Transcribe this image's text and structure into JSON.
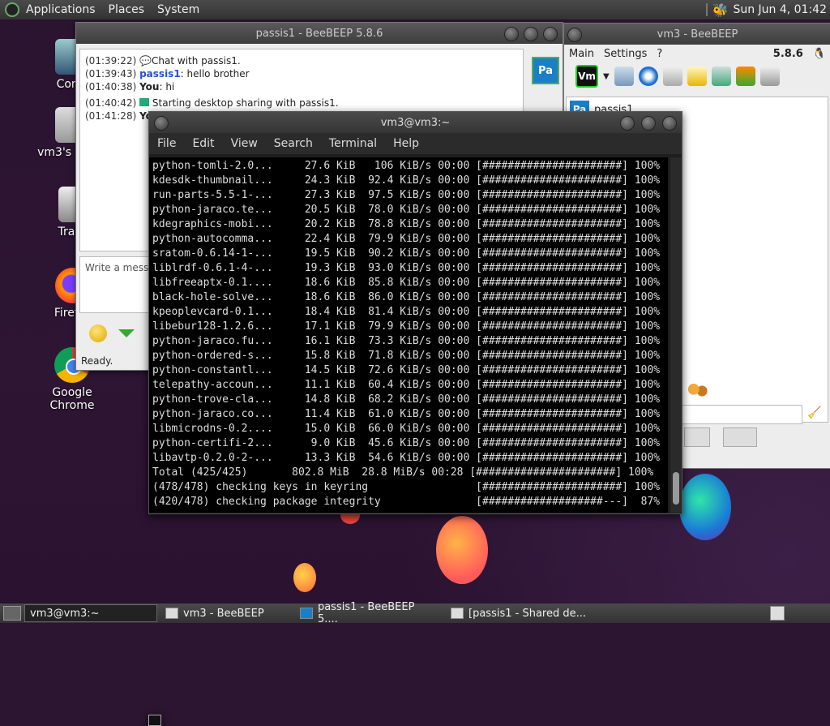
{
  "topbar": {
    "menus": [
      "Applications",
      "Places",
      "System"
    ],
    "clock": "Sun Jun  4, 01:42"
  },
  "desktop_icons": [
    {
      "label": "Comp"
    },
    {
      "label": "vm3's Home"
    },
    {
      "label": "Trash"
    },
    {
      "label": "Firefox"
    },
    {
      "label": "Google Chrome"
    }
  ],
  "chat_window": {
    "title": "passis1 - BeeBEEP 5.8.6",
    "lines": [
      {
        "time": "(01:39:22)",
        "text": "Chat with passis1."
      },
      {
        "time": "(01:39:43)",
        "nick": "passis1",
        "text": ": hello brother"
      },
      {
        "time": "(01:40:38)",
        "you": "You",
        "text": ": hi"
      },
      {
        "time": "(01:40:42)",
        "text": "Starting desktop sharing with passis1."
      },
      {
        "time": "(01:41:28)",
        "you": "You",
        "text": ""
      }
    ],
    "input_placeholder": "Write a messa",
    "status": "Ready.",
    "avatar": "Pa"
  },
  "main_window": {
    "title": "vm3 - BeeBEEP",
    "menus": [
      "Main",
      "Settings",
      "?"
    ],
    "version": "5.8.6",
    "vm_badge": "Vm",
    "user_badge": "Pa",
    "user_name": "passis1"
  },
  "terminal": {
    "title": "vm3@vm3:~",
    "menus": [
      "File",
      "Edit",
      "View",
      "Search",
      "Terminal",
      "Help"
    ],
    "lines": [
      "python-tomli-2.0...     27.6 KiB   106 KiB/s 00:00 [######################] 100%",
      "kdesdk-thumbnail...     24.3 KiB  92.4 KiB/s 00:00 [######################] 100%",
      "run-parts-5.5-1-...     27.3 KiB  97.5 KiB/s 00:00 [######################] 100%",
      "python-jaraco.te...     20.5 KiB  78.0 KiB/s 00:00 [######################] 100%",
      "kdegraphics-mobi...     20.2 KiB  78.8 KiB/s 00:00 [######################] 100%",
      "python-autocomma...     22.4 KiB  79.9 KiB/s 00:00 [######################] 100%",
      "sratom-0.6.14-1-...     19.5 KiB  90.2 KiB/s 00:00 [######################] 100%",
      "liblrdf-0.6.1-4-...     19.3 KiB  93.0 KiB/s 00:00 [######################] 100%",
      "libfreeaptx-0.1....     18.6 KiB  85.8 KiB/s 00:00 [######################] 100%",
      "black-hole-solve...     18.6 KiB  86.0 KiB/s 00:00 [######################] 100%",
      "kpeoplevcard-0.1...     18.4 KiB  81.4 KiB/s 00:00 [######################] 100%",
      "libebur128-1.2.6...     17.1 KiB  79.9 KiB/s 00:00 [######################] 100%",
      "python-jaraco.fu...     16.1 KiB  73.3 KiB/s 00:00 [######################] 100%",
      "python-ordered-s...     15.8 KiB  71.8 KiB/s 00:00 [######################] 100%",
      "python-constantl...     14.5 KiB  72.6 KiB/s 00:00 [######################] 100%",
      "telepathy-accoun...     11.1 KiB  60.4 KiB/s 00:00 [######################] 100%",
      "python-trove-cla...     14.8 KiB  68.2 KiB/s 00:00 [######################] 100%",
      "python-jaraco.co...     11.4 KiB  61.0 KiB/s 00:00 [######################] 100%",
      "libmicrodns-0.2....     15.0 KiB  66.0 KiB/s 00:00 [######################] 100%",
      "python-certifi-2...      9.0 KiB  45.6 KiB/s 00:00 [######################] 100%",
      "libavtp-0.2.0-2-...     13.3 KiB  54.6 KiB/s 00:00 [######################] 100%",
      "Total (425/425)       802.8 MiB  28.8 MiB/s 00:28 [######################] 100%",
      "(478/478) checking keys in keyring                 [######################] 100%",
      "(420/478) checking package integrity               [###################---]  87%"
    ]
  },
  "taskbar": [
    {
      "label": "vm3@vm3:~",
      "active": true,
      "icon": "terminal-icon"
    },
    {
      "label": "vm3 - BeeBEEP",
      "active": false,
      "icon": "window-icon"
    },
    {
      "label": "passis1 - BeeBEEP 5....",
      "active": false,
      "icon": "beebeep-icon"
    },
    {
      "label": "[passis1 - Shared de...",
      "active": false,
      "icon": "window-icon"
    }
  ]
}
